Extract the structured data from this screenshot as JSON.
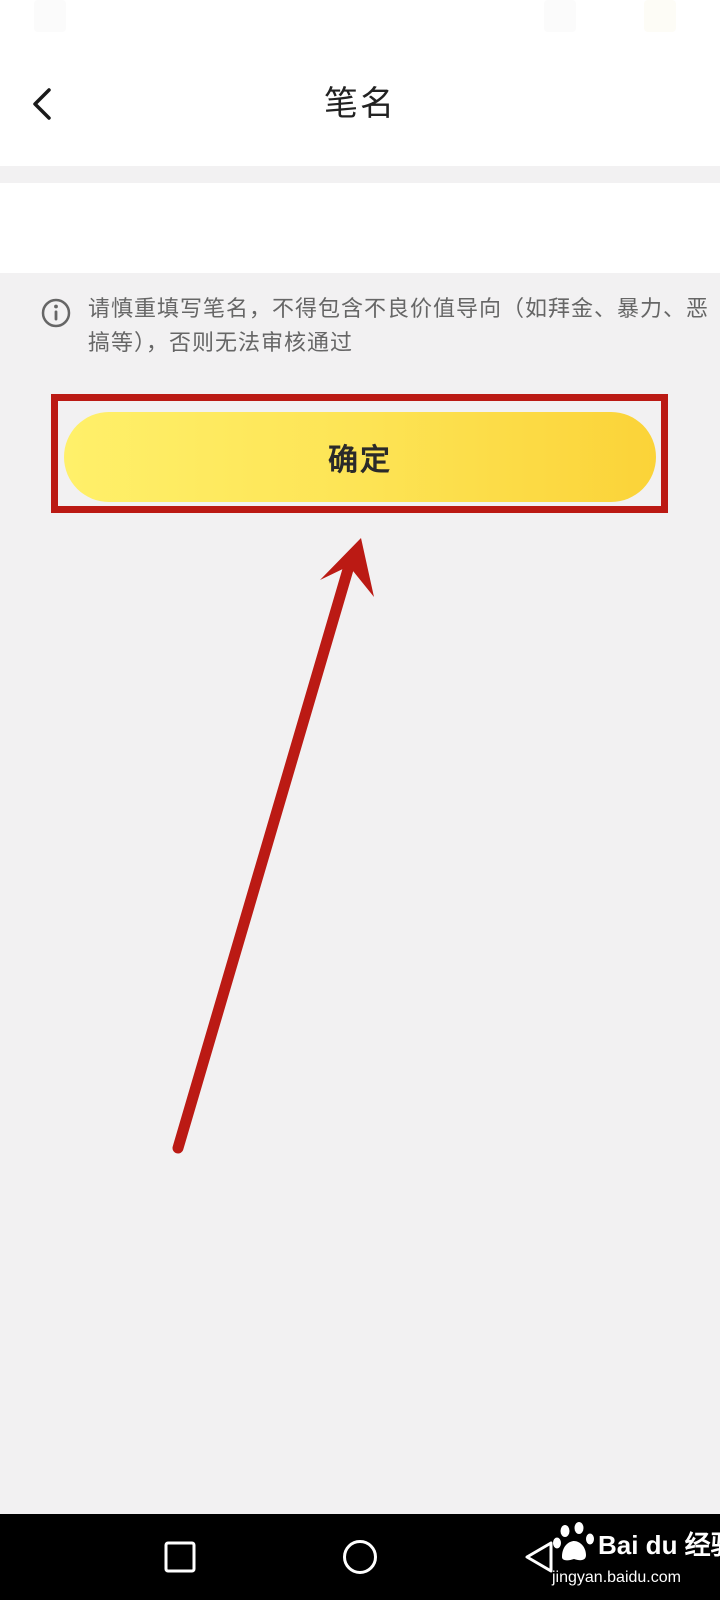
{
  "header": {
    "title": "笔名",
    "back_icon": "chevron-left-icon"
  },
  "form": {
    "penname_value": "",
    "penname_placeholder": ""
  },
  "notice": {
    "icon": "info-circle-icon",
    "text": "请慎重填写笔名，不得包含不良价值导向（如拜金、暴力、恶搞等），否则无法审核通过"
  },
  "actions": {
    "confirm_label": "确定"
  },
  "system_nav": {
    "recent_icon": "square-icon",
    "home_icon": "circle-icon",
    "back_icon": "triangle-back-icon"
  },
  "watermark": {
    "brand": "Bai du 经验",
    "url": "jingyan.baidu.com"
  },
  "colors": {
    "accent_start": "#fff06a",
    "accent_end": "#fbd338",
    "annotation_red": "#bb1a14",
    "background": "#f2f1f2"
  }
}
